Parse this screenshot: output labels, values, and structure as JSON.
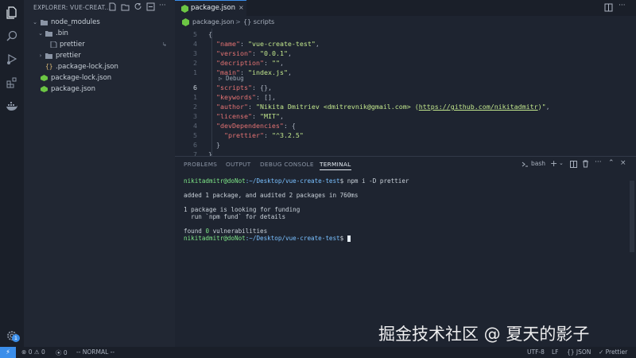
{
  "sidebar": {
    "header": "EXPLORER: VUE-CREAT...",
    "tree": [
      {
        "label": "node_modules",
        "kind": "folder-open"
      },
      {
        "label": ".bin",
        "kind": "folder-open"
      },
      {
        "label": "prettier",
        "kind": "file",
        "aux": "↳"
      },
      {
        "label": "prettier",
        "kind": "folder"
      },
      {
        "label": ".package-lock.json",
        "kind": "json"
      },
      {
        "label": "package-lock.json",
        "kind": "npm"
      },
      {
        "label": "package.json",
        "kind": "npm"
      }
    ]
  },
  "tab": {
    "label": "package.json",
    "close": "×"
  },
  "breadcrumb": {
    "file": "package.json",
    "sep": ">",
    "symbol": "{} scripts"
  },
  "editor": {
    "codelens": "Debug",
    "lines": [
      {
        "ln": "5",
        "text": "{"
      },
      {
        "ln": "4",
        "key": "\"name\"",
        "val": "\"vue-create-test\"",
        "end": ","
      },
      {
        "ln": "3",
        "key": "\"version\"",
        "val": "\"0.0.1\"",
        "end": ","
      },
      {
        "ln": "2",
        "key": "\"decription\"",
        "val": "\"\"",
        "end": ","
      },
      {
        "ln": "1",
        "key": "\"main\"",
        "val": "\"index.js\"",
        "end": ","
      },
      {
        "ln": "6",
        "key": "\"scripts\"",
        "val": "{}",
        "end": ","
      },
      {
        "ln": "1",
        "key": "\"keywords\"",
        "val": "[]",
        "end": ","
      },
      {
        "ln": "2",
        "key": "\"author\"",
        "val": "\"Nikita Dmitriev <dmitrevnik@gmail.com> (",
        "link": "https://github.com/nikitadmitr",
        "val2": ")\"",
        "end": ","
      },
      {
        "ln": "3",
        "key": "\"license\"",
        "val": "\"MIT\"",
        "end": ","
      },
      {
        "ln": "4",
        "key": "\"devDependencies\"",
        "val": "{",
        "end": ""
      },
      {
        "ln": "5",
        "key": "\"prettier\"",
        "val": "\"^3.2.5\"",
        "end": ""
      },
      {
        "ln": "6",
        "text": "}"
      },
      {
        "ln": "7",
        "text": "}"
      }
    ]
  },
  "panel": {
    "tabs": [
      "PROBLEMS",
      "OUTPUT",
      "DEBUG CONSOLE",
      "TERMINAL"
    ],
    "shell": "bash",
    "terminal": {
      "prompt_user": "nikitadmitr@doNot",
      "prompt_path": ":~/Desktop/vue-create-test",
      "command": "$ npm i -D prettier",
      "out1": "added 1 package, and audited 2 packages in 760ms",
      "out2": "1 package is looking for funding",
      "out3": "  run `npm fund` for details",
      "out4_a": "found ",
      "out4_num": "0",
      "out4_b": " vulnerabilities",
      "prompt_end": "$"
    }
  },
  "watermark": "掘金技术社区 @ 夏天的影子",
  "statusbar": {
    "remote": "⚡",
    "errors": "0",
    "warnings": "0",
    "ports": "0",
    "mode": "-- NORMAL --",
    "encoding": "UTF-8",
    "eol": "LF",
    "language": "{} JSON",
    "formatter": "✓ Prettier"
  },
  "activity": {
    "badge": "1"
  },
  "colors": {
    "accent": "#3b8eea",
    "key": "#e57373",
    "string": "#c3e88d",
    "prompt_user": "#7ee787",
    "prompt_path": "#79c0ff"
  }
}
